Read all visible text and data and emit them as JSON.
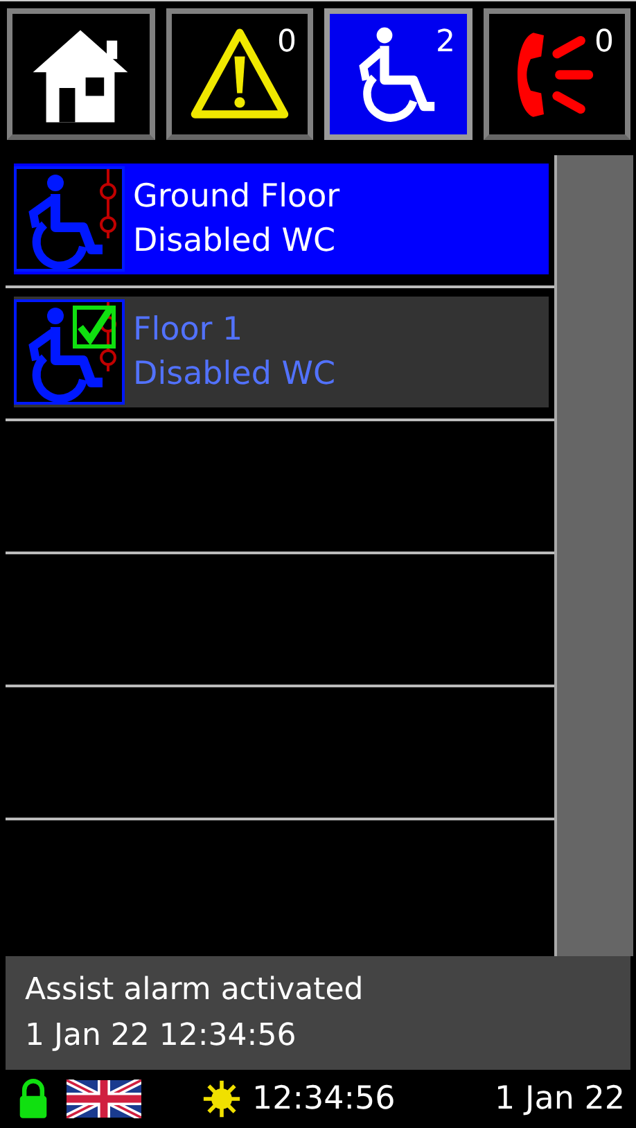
{
  "tabs": [
    {
      "kind": "home",
      "selected": false
    },
    {
      "kind": "warning",
      "count": "0",
      "selected": false
    },
    {
      "kind": "accessible",
      "count": "2",
      "selected": true
    },
    {
      "kind": "phone",
      "count": "0",
      "selected": false
    }
  ],
  "alarms": [
    {
      "location": "Ground Floor",
      "type": "Disabled WC",
      "selected": true,
      "acknowledged": false
    },
    {
      "location": "Floor 1",
      "type": "Disabled WC",
      "selected": false,
      "acknowledged": true
    }
  ],
  "message": {
    "text": "Assist alarm activated",
    "timestamp": "1 Jan 22 12:34:56"
  },
  "status_bar": {
    "locked": true,
    "time": "12:34:56",
    "date": "1 Jan 22"
  }
}
